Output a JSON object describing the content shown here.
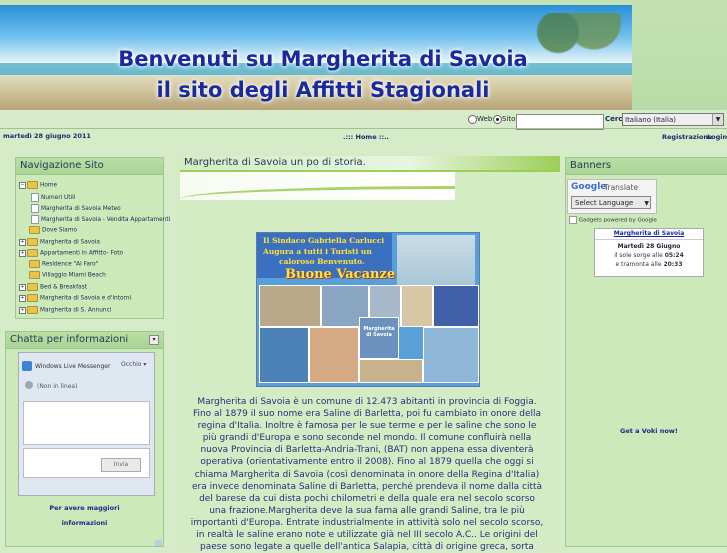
{
  "banner": {
    "line1": "Benvenuti su Margherita di Savoia",
    "line2": "il sito degli Affitti Stagionali"
  },
  "search": {
    "web_label": "Web",
    "site_label": "Sito",
    "query_value": "",
    "search_label": "Cerca",
    "language_selected": "Italiano (Italia)"
  },
  "navbar": {
    "date": "martedì 28 giugno 2011",
    "home_link": ".::: Home ::..",
    "registration": "Registrazione",
    "login": "Login"
  },
  "nav_panel": {
    "title": "Navigazione Sito",
    "items": [
      {
        "label": "Home",
        "icon": "folder-open-icon",
        "toggle": "−"
      },
      {
        "label": "Numeri Utili",
        "icon": "page-icon"
      },
      {
        "label": "Margherita di Savoia Meteo",
        "icon": "page-icon"
      },
      {
        "label": "Margherita di Savoia - Vendita Appartamenti",
        "icon": "page-icon"
      },
      {
        "label": "Dove Siamo",
        "icon": "folder-icon"
      },
      {
        "label": "Margherita di Savoia",
        "icon": "folder-icon",
        "toggle": "+"
      },
      {
        "label": "Appartamenti in Affitto- Foto",
        "icon": "folder-icon",
        "toggle": "+"
      },
      {
        "label": "Residence \"Al Faro\"",
        "icon": "folder-icon"
      },
      {
        "label": "Villaggio Miami Beach",
        "icon": "folder-icon"
      },
      {
        "label": "Bed & Breakfast",
        "icon": "folder-icon",
        "toggle": "+"
      },
      {
        "label": "Margherita di Savoia e d'intorni",
        "icon": "folder-icon",
        "toggle": "+"
      },
      {
        "label": "Margherita di S. Annunci",
        "icon": "folder-icon",
        "toggle": "+"
      }
    ]
  },
  "chat_panel": {
    "title": "Chatta per informazioni",
    "messenger_label": "Windows Live Messenger",
    "status": "Occhio",
    "status_sub": "(Non in linea)",
    "send_label": "Invia",
    "link_line1": "Per avere maggiori",
    "link_line2": "informazioni"
  },
  "center": {
    "title": "Margherita di Savoia un po di storia.",
    "poster": {
      "line1": "Il Sindaco Gabriella Carlucci",
      "line2": "Augura a tutti i Turisti un",
      "line3": "caloroso Benvenuto.",
      "line4": "Buone Vacanze",
      "caption": "Margherita di Savoia"
    },
    "story": "Margherita di Savoia è un comune di 12.473 abitanti in provincia di Foggia. Fino al 1879 il suo nome era Saline di Barletta, poi fu cambiato in onore della regina d'Italia. Inoltre è famosa per le sue terme e per le saline che sono le più grandi d'Europa e sono seconde nel mondo. Il comune confluirà nella nuova Provincia di Barletta-Andria-Trani, (BAT) non appena essa diventerà operativa (orientativamente entro il 2008). Fino al 1879 quella che oggi si chiama Margherita di Savoia (così denominata in onore della Regina d'Italia) era invece denominata Saline di Barletta, perché prendeva il nome dalla città del barese da cui dista pochi chilometri e della quale era nel secolo scorso una frazione.Margherita deve la sua fama alle grandi Saline, tra le più importanti d'Europa. Entrate industrialmente in attività solo nel secolo scorso, in realtà le saline erano note e utilizzate già nel III secolo A.C.. Le origini del paese sono legate a quelle dell'antica Salapia, città di origine greca, sorta"
  },
  "right_panel": {
    "title": "Banners",
    "translate_label": "Translate",
    "select_language": "Select Language",
    "gadgets_label": "Gadgets powered by Google",
    "cal_title": "Margherita di Savoia",
    "cal_date": "Martedì 28 Giugno",
    "sunrise_label": "il sole sorge alle",
    "sunrise": "05:24",
    "sunset_label": "e tramonta alle",
    "sunset": "20:33",
    "voki": "Get a Voki now!"
  }
}
